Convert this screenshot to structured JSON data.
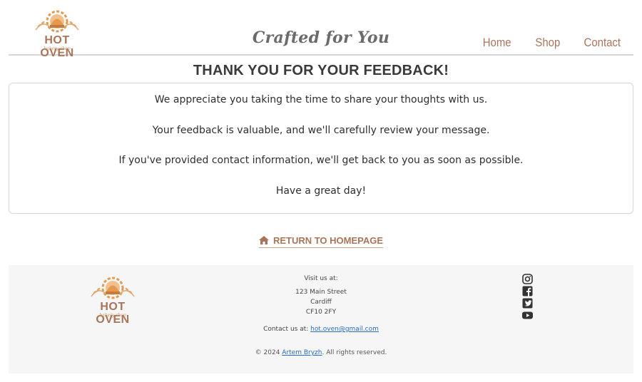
{
  "header": {
    "brand": "HOT OVEN",
    "brand_sub": "bakery shop",
    "tagline": "Crafted for You",
    "nav": [
      "Home",
      "Shop",
      "Contact"
    ]
  },
  "main": {
    "title": "THANK YOU FOR YOUR FEEDBACK!",
    "messages": [
      "We appreciate you taking the time to share your thoughts with us.",
      "Your feedback is valuable, and we'll carefully review your message.",
      "If you've provided contact information, we'll get back to you as soon as possible.",
      "Have a great day!"
    ],
    "return_label": "RETURN TO HOMEPAGE",
    "return_icon": "home-icon"
  },
  "footer": {
    "brand": "HOT OVEN",
    "brand_sub": "bakery shop",
    "visit_label": "Visit us at:",
    "address": [
      "123 Main Street",
      "Cardiff",
      "CF10 2FY"
    ],
    "contact_prefix": "Contact us at:",
    "email": "hot.oven@gmail.com",
    "copyright_prefix": "© 2024",
    "author": "Artem Bryzh",
    "copyright_suffix": ". All rights reserved.",
    "socials": [
      "instagram-icon",
      "facebook-icon",
      "twitter-icon",
      "youtube-icon"
    ]
  },
  "colors": {
    "accent": "#a8745a",
    "logo_orange": "#e49a4e",
    "link": "#2b6cc4"
  }
}
